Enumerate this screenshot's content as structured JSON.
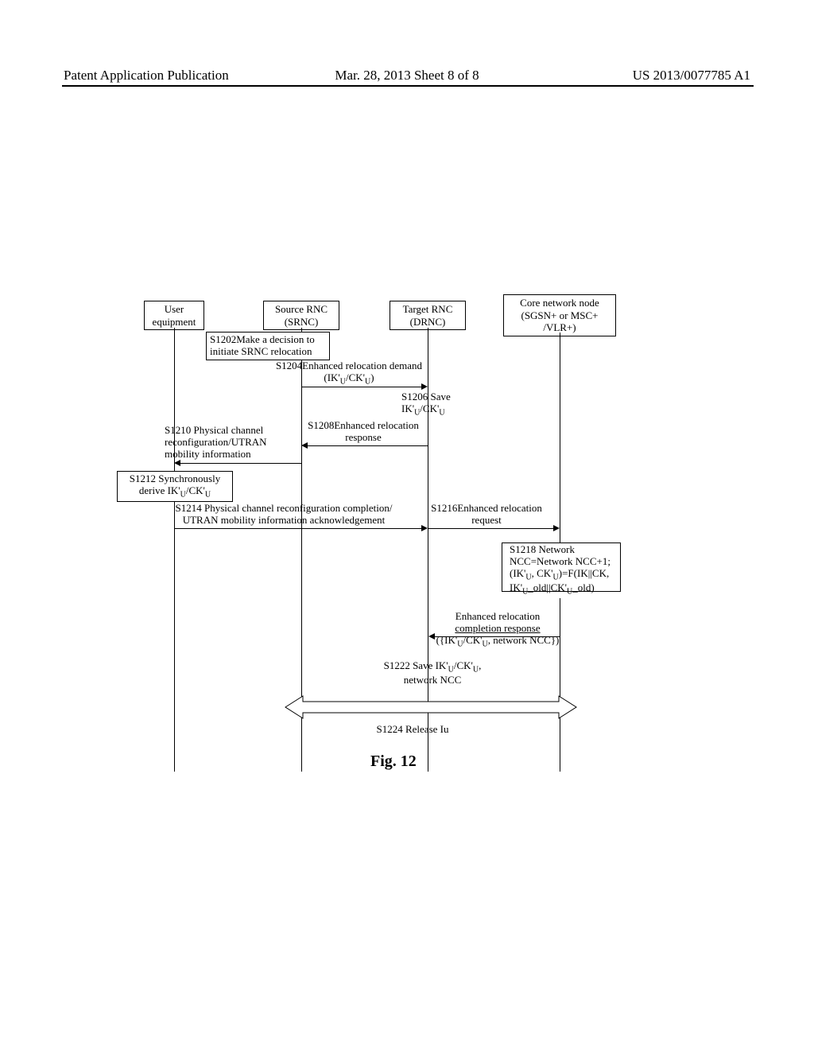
{
  "header": {
    "left": "Patent Application Publication",
    "center": "Mar. 28, 2013   Sheet 8 of 8",
    "right": "US 2013/0077785 A1"
  },
  "actors": {
    "ue": "User\nequipment",
    "srnc": "Source RNC\n(SRNC)",
    "drnc": "Target RNC\n(DRNC)",
    "core": "Core network node\n(SGSN+ or MSC+\n/VLR+)"
  },
  "steps": {
    "s1202": "S1202Make a decision to\ninitiate SRNC relocation",
    "s1204_label": "S1204Enhanced relocation demand",
    "s1204_params": "(IK'",
    "s1204_params2": "/CK'",
    "s1204_params3": ")",
    "s1206": "S1206 Save\nIK'",
    "s1206b": "/CK'",
    "s1208": "S1208Enhanced relocation\nresponse",
    "s1210": "S1210 Physical channel\nreconfiguration/UTRAN\nmobility information",
    "s1212": "S1212 Synchronously\nderive IK'",
    "s1212b": "/CK'",
    "s1214": "S1214 Physical channel reconfiguration completion/\nUTRAN mobility information acknowledgement",
    "s1216": "S1216Enhanced relocation\nrequest",
    "s1218_line1": "S1218 Network",
    "s1218_line2": "NCC=Network NCC+1;",
    "s1218_line3": "(IK'",
    "s1218_line3b": ", CK'",
    "s1218_line3c": ")=F(IK||CK,",
    "s1218_line4": "IK'",
    "s1218_line4b": "_old||CK'",
    "s1218_line4c": "_old)",
    "s1220_line1": "Enhanced relocation",
    "s1220_line2": "completion response",
    "s1220_line3a": "({IK'",
    "s1220_line3b": "/CK'",
    "s1220_line3c": ", network NCC})",
    "s1222": "S1222 Save IK'",
    "s1222b": "/CK'",
    "s1222c": ",\nnetwork NCC",
    "s1224": "S1224 Release Iu"
  },
  "caption": "Fig. 12",
  "sub_u": "U"
}
